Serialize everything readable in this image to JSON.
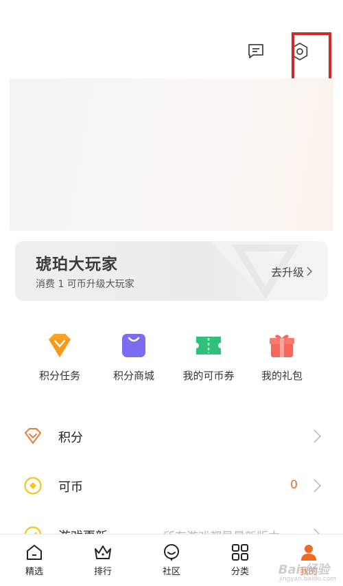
{
  "header": {
    "message_icon": "message-icon",
    "settings_icon": "settings-hexagon-icon"
  },
  "member": {
    "title": "琥珀大玩家",
    "subtitle": "消费 1 可币升级大玩家",
    "upgrade_label": "去升级"
  },
  "quick_actions": [
    {
      "label": "积分任务",
      "icon": "diamond-icon",
      "color": "#f7a325"
    },
    {
      "label": "积分商城",
      "icon": "shopping-bag-icon",
      "color": "#7b6cf0"
    },
    {
      "label": "我的可币券",
      "icon": "ticket-icon",
      "color": "#2fc07a"
    },
    {
      "label": "我的礼包",
      "icon": "gift-icon",
      "color": "#f2685a"
    }
  ],
  "list": [
    {
      "label": "积分",
      "icon": "diamond-outline-icon",
      "value": ""
    },
    {
      "label": "可币",
      "icon": "coin-icon",
      "value": "0"
    },
    {
      "label": "游戏更新",
      "icon": "update-icon",
      "value": "",
      "hint": "所有游戏都是最新版本"
    }
  ],
  "tabs": [
    {
      "label": "精选",
      "icon": "home-icon"
    },
    {
      "label": "排行",
      "icon": "crown-icon"
    },
    {
      "label": "社区",
      "icon": "chat-bubble-icon"
    },
    {
      "label": "分类",
      "icon": "grid-icon"
    },
    {
      "label": "我的",
      "icon": "person-icon",
      "active": true
    }
  ],
  "colors": {
    "accent": "#f06a25",
    "highlight": "#d12a2a"
  },
  "watermark": {
    "text": "Bai  经验",
    "sub": "jingyan.baidu.com"
  }
}
